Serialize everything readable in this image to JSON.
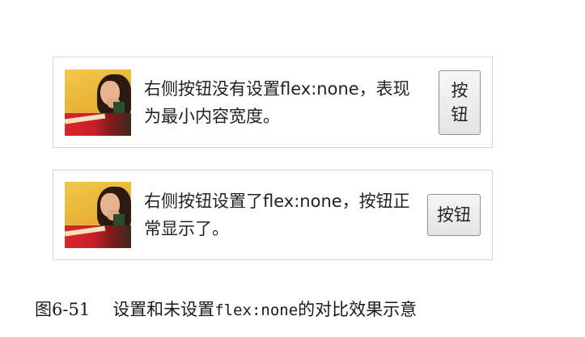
{
  "example_without_flex_none": {
    "description": "右侧按钮没有设置flex:none，表现为最小内容宽度。",
    "button_label": "按钮"
  },
  "example_with_flex_none": {
    "description": "右侧按钮设置了flex:none，按钮正常显示了。",
    "button_label": "按钮"
  },
  "caption": {
    "figure_number": "图6-51",
    "text_before": "设置和未设置",
    "code": "flex:none",
    "text_after": "的对比效果示意"
  }
}
